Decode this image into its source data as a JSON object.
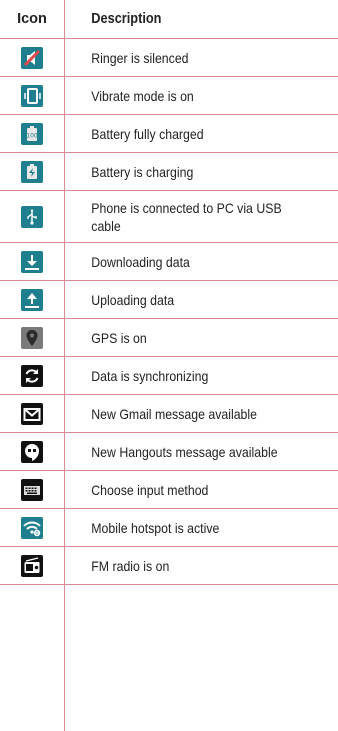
{
  "table": {
    "header": {
      "icon": "Icon",
      "description": "Description"
    },
    "rows": [
      {
        "icon": "ringer-silenced-icon",
        "description": "Ringer is silenced"
      },
      {
        "icon": "vibrate-icon",
        "description": "Vibrate mode is on"
      },
      {
        "icon": "battery-full-icon",
        "description": "Battery fully charged"
      },
      {
        "icon": "battery-charging-icon",
        "description": "Battery is charging"
      },
      {
        "icon": "usb-icon",
        "description": "Phone is connected to PC via USB cable"
      },
      {
        "icon": "download-icon",
        "description": "Downloading data"
      },
      {
        "icon": "upload-icon",
        "description": "Uploading data"
      },
      {
        "icon": "gps-icon",
        "description": "GPS is on"
      },
      {
        "icon": "sync-icon",
        "description": "Data is synchronizing"
      },
      {
        "icon": "gmail-icon",
        "description": "New Gmail message available"
      },
      {
        "icon": "hangouts-icon",
        "description": "New Hangouts message available"
      },
      {
        "icon": "keyboard-icon",
        "description": "Choose input method"
      },
      {
        "icon": "hotspot-icon",
        "description": "Mobile hotspot is active"
      },
      {
        "icon": "fm-radio-icon",
        "description": "FM radio is on"
      }
    ]
  },
  "colors": {
    "rule": "#d98a95",
    "icon_teal": "#1f7f8f",
    "icon_dark": "#111111"
  }
}
